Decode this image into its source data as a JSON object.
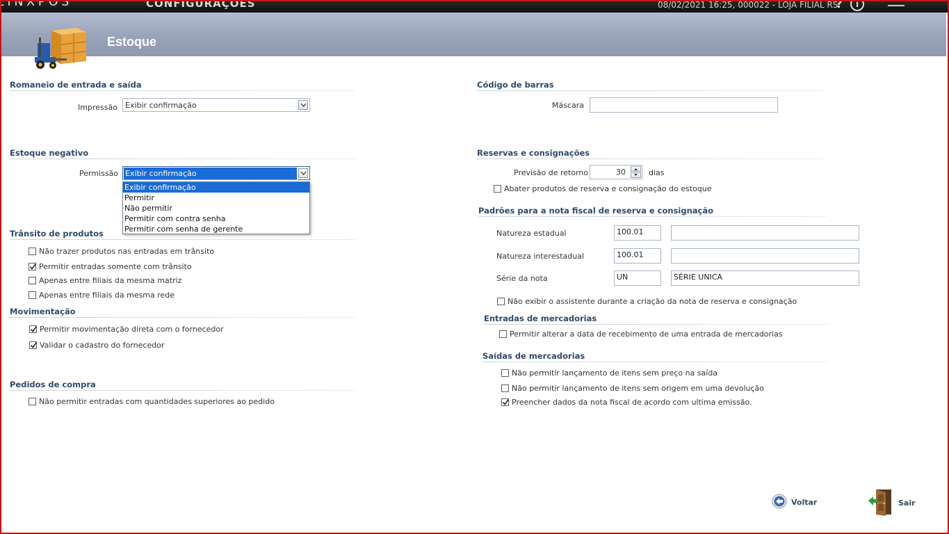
{
  "topbar": {
    "brand": "LINXPOS",
    "app_title": "CONFIGURAÇÕES",
    "session": "08/02/2021 16:25, 000022 - LOJA FILIAL RS.",
    "help": "?",
    "info": "i"
  },
  "header": {
    "title": "Estoque",
    "logo_icon": "warehouse-forklift-icon"
  },
  "left": {
    "romaneio": {
      "title": "Romaneio de entrada e saída",
      "label": "Impressão",
      "value": "Exibir confirmação"
    },
    "estoque_negativo": {
      "title": "Estoque negativo",
      "label": "Permissão",
      "value": "Exibir confirmação",
      "options": [
        "Exibir confirmação",
        "Permitir",
        "Não permitir",
        "Permitir com contra senha",
        "Permitir com senha de gerente"
      ]
    },
    "transito": {
      "title": "Trânsito de produtos",
      "items": [
        {
          "label": "Não trazer produtos nas entradas em trânsito",
          "checked": false
        },
        {
          "label": "Permitir entradas somente com trânsito",
          "checked": true
        },
        {
          "label": "Apenas entre filiais da mesma matriz",
          "checked": false
        },
        {
          "label": "Apenas entre filiais da mesma rede",
          "checked": false
        }
      ]
    },
    "movimentacao": {
      "title": "Movimentação",
      "items": [
        {
          "label": "Permitir movimentação direta com o fornecedor",
          "checked": true
        },
        {
          "label": "Validar o cadastro do fornecedor",
          "checked": true
        }
      ]
    },
    "pedidos": {
      "title": "Pedidos de compra",
      "items": [
        {
          "label": "Não permitir entradas com quantidades superiores ao pedido",
          "checked": false
        }
      ]
    }
  },
  "right": {
    "codigo_barras": {
      "title": "Código de barras",
      "label": "Máscara",
      "value": ""
    },
    "reservas": {
      "title": "Reservas e consignações",
      "previsao_label": "Previsão de retorno",
      "previsao_value": "30",
      "previsao_unit": "dias",
      "abater": {
        "label": "Abater produtos de reserva e consignação do estoque",
        "checked": false
      }
    },
    "padroes": {
      "title": "Padrões para a nota fiscal de reserva e consignação",
      "natureza_estadual_label": "Natureza estadual",
      "natureza_estadual_code": "100.01",
      "natureza_estadual_desc": "",
      "natureza_interestadual_label": "Natureza interestadual",
      "natureza_interestadual_code": "100.01",
      "natureza_interestadual_desc": "",
      "serie_label": "Série da nota",
      "serie_code": "UN",
      "serie_desc": "SÉRIE UNICA",
      "assistente": {
        "label": "Não exibir o assistente durante a criação da nota de reserva e consignação",
        "checked": false
      }
    },
    "entradas": {
      "title": "Entradas de mercadorias",
      "items": [
        {
          "label": "Permitir alterar a data de recebimento de uma entrada de mercadorias",
          "checked": false
        }
      ]
    },
    "saidas": {
      "title": "Saídas de mercadorias",
      "items": [
        {
          "label": "Não permitir lançamento de itens sem preço na saída",
          "checked": false
        },
        {
          "label": "Não permitir lançamento de itens sem origem em uma devolução",
          "checked": false
        },
        {
          "label": "Preencher dados da nota fiscal de acordo com ultima emissão.",
          "checked": true
        }
      ]
    }
  },
  "footer": {
    "back_label": "Voltar",
    "back_icon": "arrow-left-circle-icon",
    "exit_label": "Sair",
    "exit_icon": "exit-door-icon"
  },
  "colors": {
    "frame": "#cc1111",
    "header": "#98a3ba",
    "section_title": "#2e4a6b",
    "selection": "#1a6bd6"
  }
}
